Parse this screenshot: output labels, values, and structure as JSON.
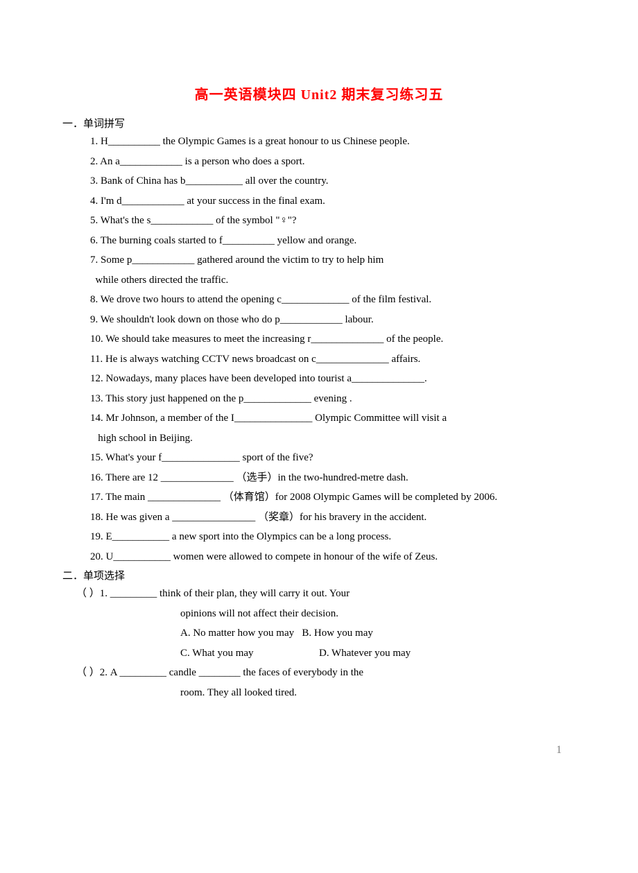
{
  "title": "高一英语模块四 Unit2 期末复习练习五",
  "section1": {
    "head": "一．单词拼写",
    "items": [
      "1. H__________ the Olympic Games is a great honour to us Chinese people.",
      "2. An a____________ is a person who does a sport.",
      "3. Bank of China has b___________ all over the country.",
      "4. I'm d____________ at your success in the final exam.",
      "5. What's the s____________ of the symbol \"♀\"?",
      "6. The burning coals started to f__________ yellow and orange.",
      "7. Some p____________ gathered around the victim to try to help him",
      "  while others directed the traffic.",
      "8. We drove two hours to attend the opening c_____________ of the film festival.",
      "9. We shouldn't look down on those who do p____________ labour.",
      "10. We should take measures to meet the increasing r______________ of the people.",
      "11. He is always watching CCTV news broadcast on c______________ affairs.",
      "12. Nowadays, many places have been developed into tourist a______________.",
      "13. This story just happened on the p_____________ evening .",
      "14. Mr Johnson, a member of the I_______________ Olympic Committee will visit a",
      "   high school in Beijing.",
      "15. What's your f_______________ sport of the five?",
      "16. There are 12 ______________ （选手）in the two-hundred-metre dash.",
      "17. The main ______________ （体育馆）for 2008 Olympic Games will be completed by 2006.",
      "18. He was given a ________________ （奖章）for his bravery in the accident.",
      "19. E___________ a new sport into the Olympics can be a long process.",
      "20. U___________ women were allowed to compete in honour of the wife of Zeus."
    ]
  },
  "section2": {
    "head": "二．单项选择",
    "q1": {
      "num": "（   ）1. ",
      "stem1": "_________ think of their plan, they will carry it out. Your",
      "stem2": "opinions will not affect their decision.",
      "optA": "A. No matter how you may",
      "optB": "B. How you may",
      "optC": "C. What you may",
      "optD": "D. Whatever you may"
    },
    "q2": {
      "num": "（   ）2. ",
      "stem1": "A _________ candle ________ the faces of everybody in the",
      "stem2": "room. They all looked tired."
    }
  },
  "pageNumber": "1"
}
